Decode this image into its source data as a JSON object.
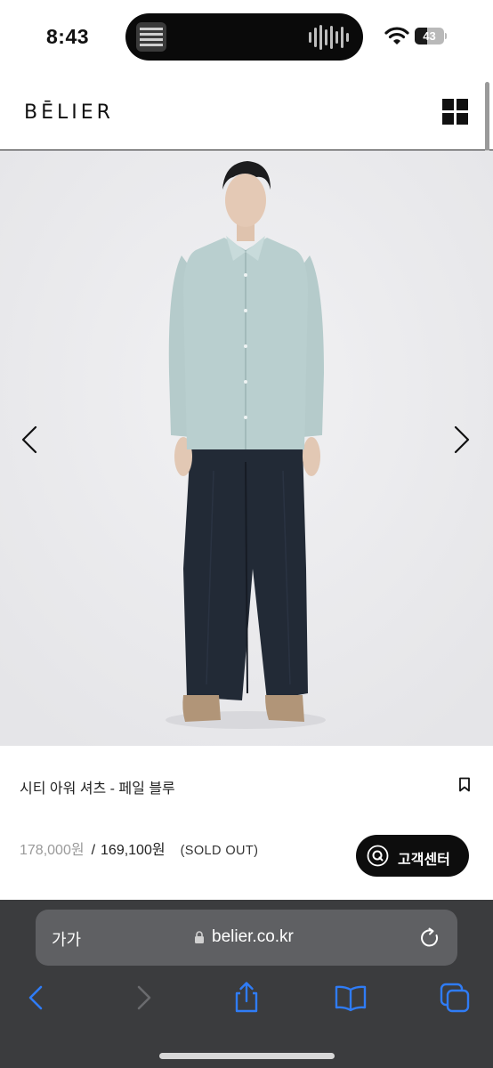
{
  "status_bar": {
    "time": "8:43",
    "battery_text": "43",
    "battery_level": 0.43,
    "wifi_icon": "wifi-icon",
    "now_playing_icon": "album-art-icon",
    "waveform_icon": "waveform-icon"
  },
  "header": {
    "logo": "BĒLIER",
    "menu_icon": "grid-menu-icon"
  },
  "gallery": {
    "prev_icon": "chevron-left-icon",
    "next_icon": "chevron-right-icon"
  },
  "product": {
    "title": "시티 아워 셔츠 - 페일 블루",
    "price_original": "178,000원",
    "price_separator": "/",
    "price_sale": "169,100원",
    "status": "(SOLD OUT)",
    "bookmark_icon": "bookmark-icon"
  },
  "customer_service": {
    "label": "고객센터",
    "icon": "q-chat-icon"
  },
  "browser": {
    "aa_label": "가가",
    "url": "belier.co.kr",
    "lock_icon": "lock-icon",
    "reload_icon": "reload-icon",
    "toolbar": [
      "back-icon",
      "forward-icon",
      "share-icon",
      "bookmarks-icon",
      "tabs-icon"
    ],
    "accent": "#2f7cf6"
  },
  "colors": {
    "image_background": "#e9e9eb",
    "shirt": "#b9cfcf",
    "pants": "#222a36",
    "button_background": "#0d0d0d"
  }
}
